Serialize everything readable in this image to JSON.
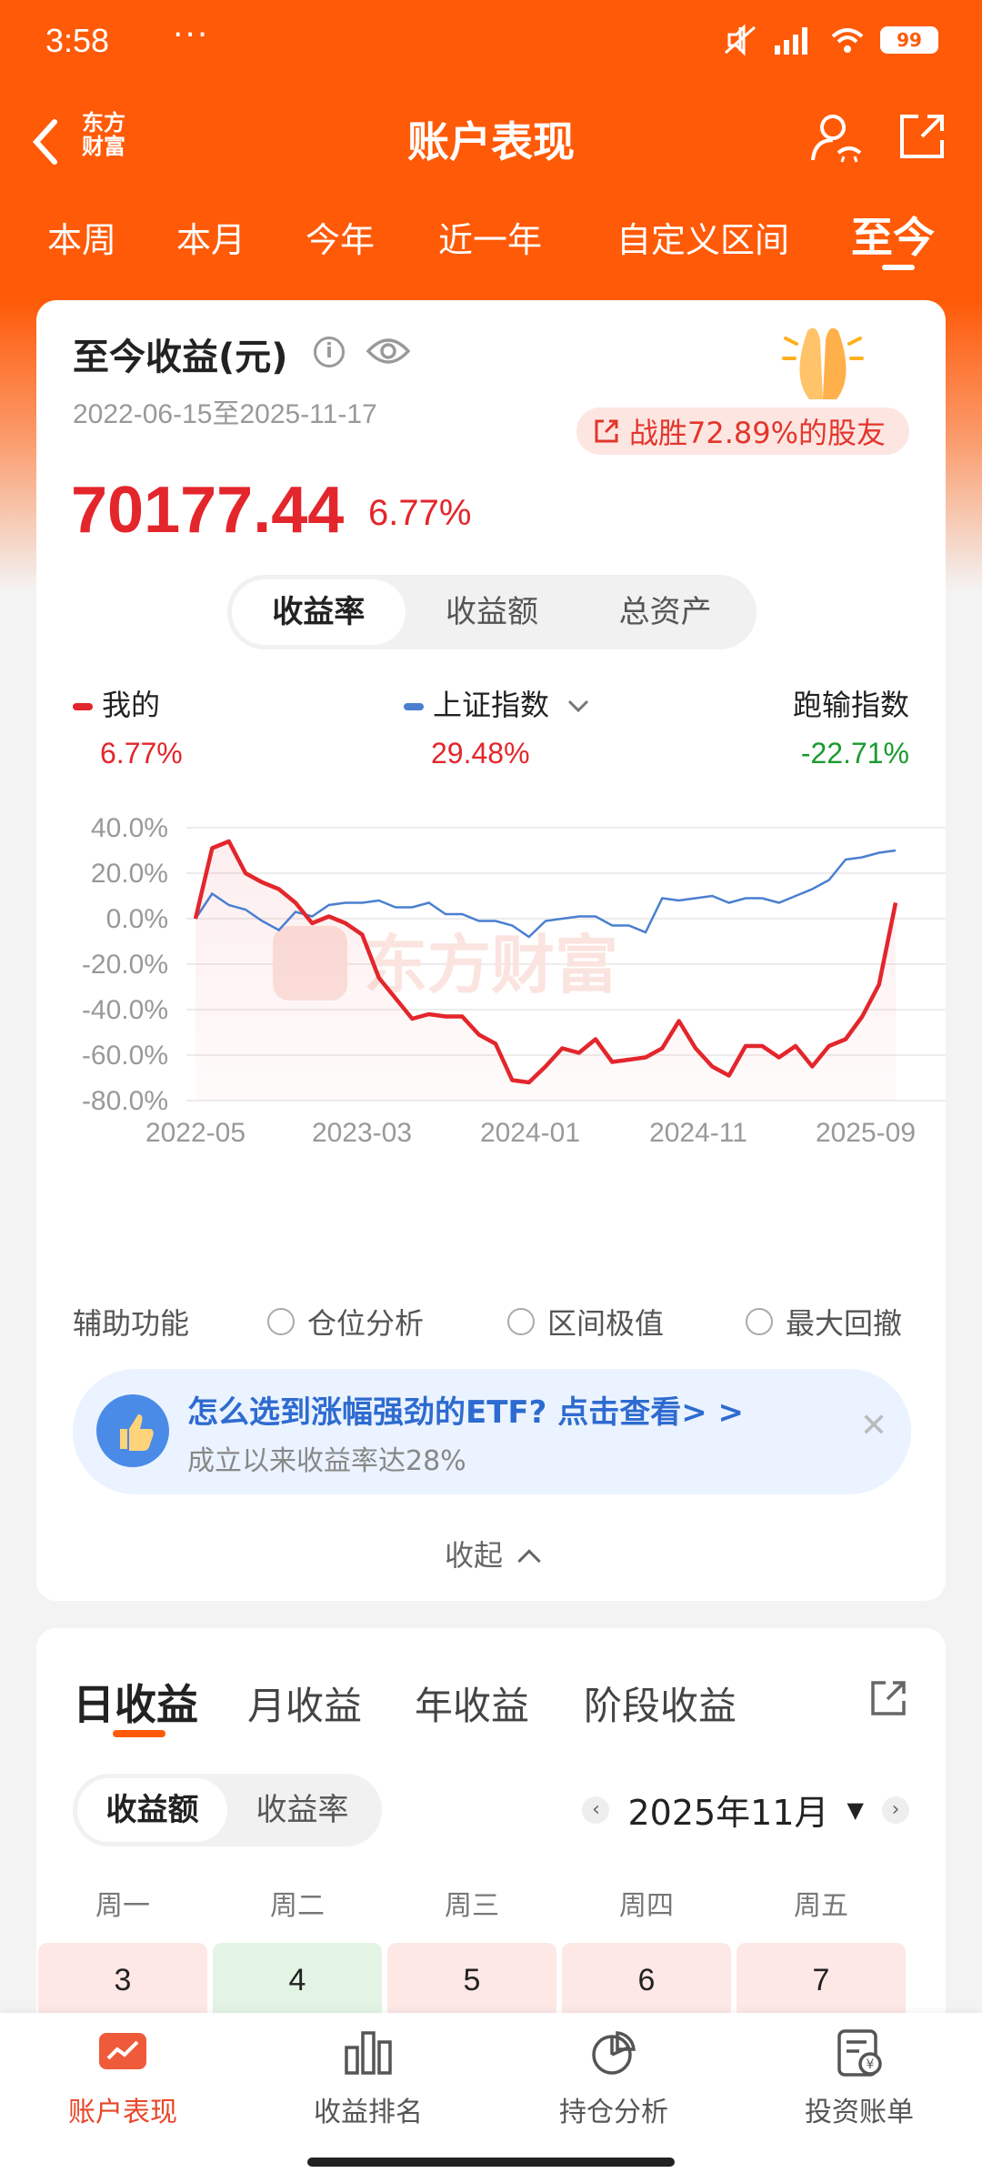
{
  "status": {
    "time": "3:58",
    "dots": "···",
    "battery": "99"
  },
  "nav": {
    "logo_line1": "东方",
    "logo_line2": "财富",
    "title": "账户表现"
  },
  "period_tabs": [
    "本周",
    "本月",
    "今年",
    "近一年",
    "自定义区间",
    "至今"
  ],
  "summary": {
    "title": "至今收益(元)",
    "info_icon": "info-icon",
    "date_range": "2022-06-15至2025-11-17",
    "beat_text": "战胜72.89%的股友",
    "value": "70177.44",
    "rate": "6.77%",
    "seg": [
      "收益率",
      "收益额",
      "总资产"
    ]
  },
  "legend": {
    "mine_label": "我的",
    "mine_value": "6.77%",
    "index_label": "上证指数",
    "index_value": "29.48%",
    "diff_label": "跑输指数",
    "diff_value": "-22.71%"
  },
  "colors": {
    "accent": "#ff5a08",
    "mine": "#e3262c",
    "index": "#4a7fd0",
    "diff": "#1a9b2f"
  },
  "chart_data": {
    "type": "line",
    "ylim": [
      -80,
      40
    ],
    "yticks": [
      "40.0%",
      "20.0%",
      "0.0%",
      "-20.0%",
      "-40.0%",
      "-60.0%",
      "-80.0%"
    ],
    "xticks": [
      "2022-05",
      "2023-03",
      "2024-01",
      "2024-11",
      "2025-09"
    ],
    "watermark": "东方财富",
    "series": [
      {
        "name": "我的",
        "color": "#e3262c",
        "values": [
          0,
          31,
          34,
          20,
          16,
          13,
          7,
          -2,
          1,
          -2,
          -7,
          -26,
          -35,
          -44,
          -42,
          -43,
          -43,
          -51,
          -55,
          -71,
          -72,
          -65,
          -57,
          -59,
          -53,
          -63,
          -62,
          -61,
          -57,
          -45,
          -57,
          -65,
          -69,
          -56,
          -56,
          -61,
          -56,
          -65,
          -56,
          -53,
          -43,
          -29,
          7
        ]
      },
      {
        "name": "上证指数",
        "color": "#4a7fd0",
        "values": [
          0,
          11,
          6,
          4,
          -1,
          -5,
          3,
          1,
          6,
          7,
          7,
          8,
          5,
          5,
          7,
          2,
          2,
          -1,
          -1,
          -3,
          -8,
          -1,
          0,
          1,
          1,
          -3,
          -3,
          -6,
          9,
          8,
          9,
          10,
          7,
          9,
          9,
          7,
          10,
          13,
          17,
          26,
          27,
          29,
          30
        ]
      }
    ]
  },
  "aux": {
    "label": "辅助功能",
    "items": [
      "仓位分析",
      "区间极值",
      "最大回撤"
    ]
  },
  "promo": {
    "title": "怎么选到涨幅强劲的ETF? 点击查看> >",
    "subtitle": "成立以来收益率达28%",
    "close": "✕"
  },
  "collapse_label": "收起",
  "returns": {
    "tabs": [
      "日收益",
      "月收益",
      "年收益",
      "阶段收益"
    ],
    "seg": [
      "收益额",
      "收益率"
    ],
    "month": "2025年11月",
    "weekdays": [
      "周一",
      "周二",
      "周三",
      "周四",
      "周五"
    ],
    "days": [
      {
        "day": "3",
        "color": "#fde8e6"
      },
      {
        "day": "4",
        "color": "#e3f4e4"
      },
      {
        "day": "5",
        "color": "#fde8e6"
      },
      {
        "day": "6",
        "color": "#fde8e6"
      },
      {
        "day": "7",
        "color": "#fde8e6"
      }
    ]
  },
  "bottom_nav": [
    "账户表现",
    "收益排名",
    "持仓分析",
    "投资账单"
  ]
}
